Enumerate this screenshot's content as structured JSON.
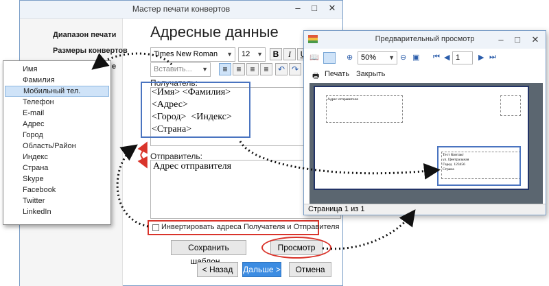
{
  "wizard": {
    "title": "Мастер печати конвертов",
    "nav": [
      "Диапазон печати",
      "Размеры конвертов",
      "е"
    ],
    "heading": "Адресные данные",
    "font_name": "Times New Roman",
    "font_size": "12",
    "bold": "B",
    "italic": "I",
    "underline": "U",
    "insert_label": "Вставить...",
    "recipient_label": "Получатель:",
    "recipient_lines": [
      "<Имя> <Фамилия>",
      "<Адрес>",
      "<Город>  <Индекс>",
      "<Страна>"
    ],
    "sender_label": "Отправитель:",
    "sender_text": "Адрес отправителя",
    "invert_label": "Инвертировать адреса Получателя и Отправителя",
    "save_template": "Сохранить шаблон...",
    "preview_button": "Просмотр",
    "back": "< Назад",
    "next": "Дальше >",
    "cancel": "Отмена"
  },
  "fields": [
    "Имя",
    "Фамилия",
    "Мобильный тел.",
    "Телефон",
    "E-mail",
    "Адрес",
    "Город",
    "Область/Район",
    "Индекс",
    "Страна",
    "Skype",
    "Facebook",
    "Twitter",
    "LinkedIn"
  ],
  "preview": {
    "title": "Предварительный просмотр",
    "zoom": "50%",
    "page_num": "1",
    "print": "Печать",
    "close": "Закрыть",
    "sender_placeholder": "Адрес отправителя",
    "recipient_lines": [
      "Тест Контакт",
      "ул. Центральная",
      "Город  123456",
      "Страна"
    ],
    "status": "Страница 1 из 1"
  },
  "colors": {
    "highlight_box": "#4a74c0",
    "red_outline": "#d9342b",
    "primary_button": "#3c8ce2"
  }
}
